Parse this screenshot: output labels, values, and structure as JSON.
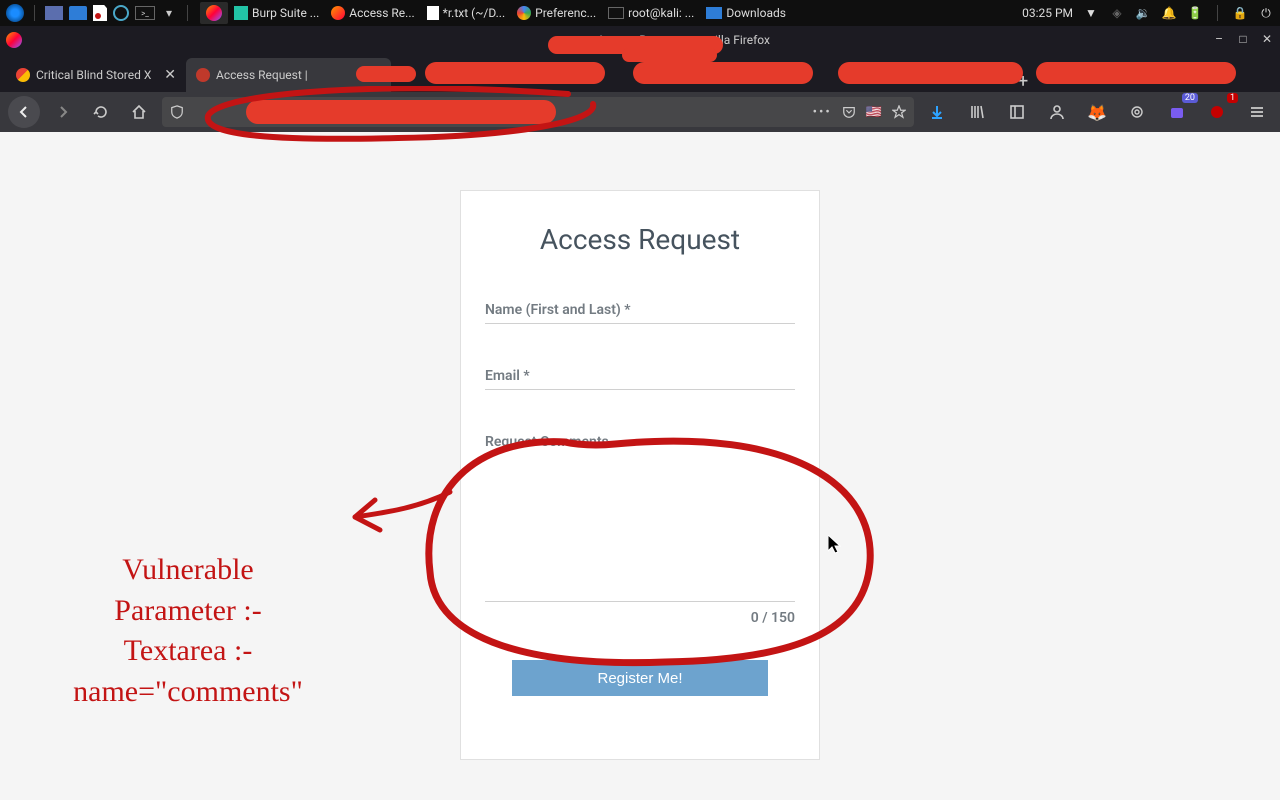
{
  "syspanel": {
    "tasks": [
      {
        "label": "",
        "icon": "firefox",
        "active": true
      },
      {
        "label": "Burp Suite ...",
        "icon": "burp"
      },
      {
        "label": "Access Re...",
        "icon": "firefox"
      },
      {
        "label": "*r.txt (~/D...",
        "icon": "editor"
      },
      {
        "label": "Preferenc...",
        "icon": "chromium"
      },
      {
        "label": "root@kali: ...",
        "icon": "terminal"
      },
      {
        "label": "Downloads",
        "icon": "files"
      }
    ],
    "clock": "03:25 PM"
  },
  "firefox": {
    "window_title_prefix": "Access Request",
    "window_title_suffix": "illa Firefox",
    "tabs": [
      {
        "label": "Critical Blind Stored X",
        "active": false,
        "icon": "gmail"
      },
      {
        "label": "Access Request | ",
        "active": true,
        "icon": "site"
      },
      {
        "label": "",
        "active": false,
        "icon": "none"
      },
      {
        "label": "",
        "active": false,
        "icon": "none"
      },
      {
        "label": "",
        "active": false,
        "icon": "none"
      }
    ],
    "badges": {
      "container": "20",
      "addon": "1"
    }
  },
  "form": {
    "title": "Access Request",
    "name_label": "Name (First and Last) *",
    "email_label": "Email *",
    "comments_label": "Request Comments",
    "counter": "0 / 150",
    "submit_label": "Register Me!"
  },
  "annotation": {
    "line1": "Vulnerable",
    "line2": "Parameter :-",
    "line3": "Textarea :-",
    "line4": "name=\"comments\""
  }
}
